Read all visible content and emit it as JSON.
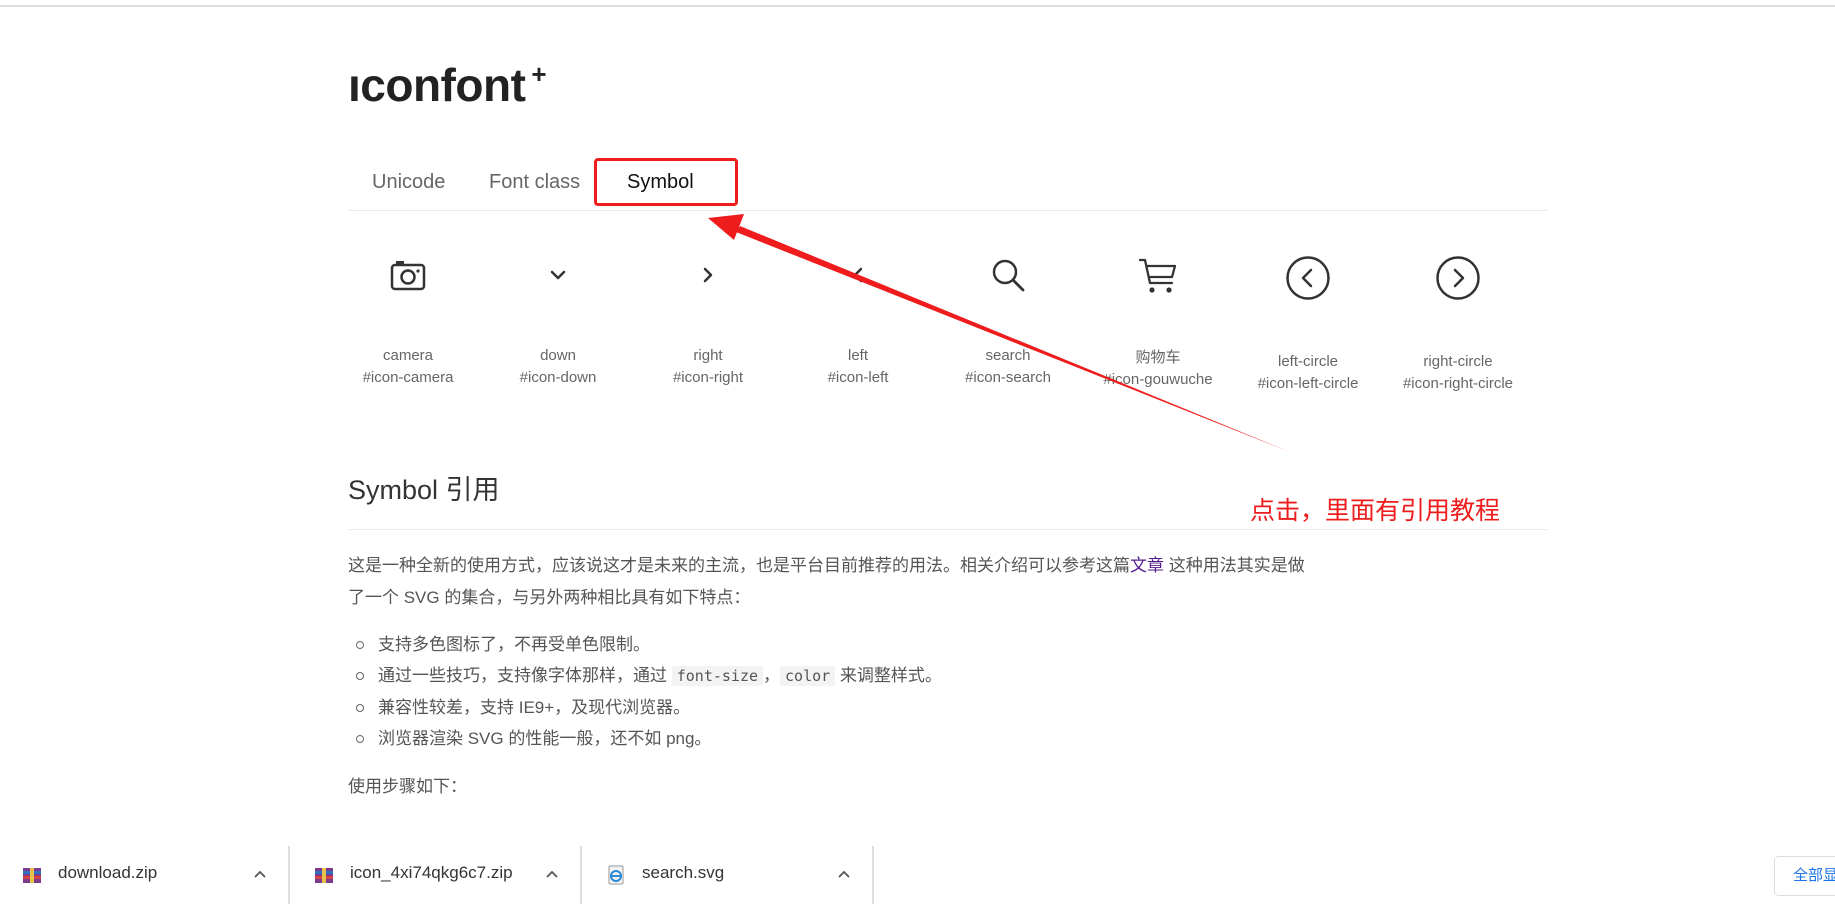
{
  "logo": {
    "text": "ıconfont",
    "plus": "+"
  },
  "tabs": [
    {
      "label": "Unicode",
      "active": false
    },
    {
      "label": "Font class",
      "active": false
    },
    {
      "label": "Symbol",
      "active": true
    }
  ],
  "icons": [
    {
      "name": "camera",
      "code": "#icon-camera",
      "icon": "camera-icon"
    },
    {
      "name": "down",
      "code": "#icon-down",
      "icon": "chevron-down-icon"
    },
    {
      "name": "right",
      "code": "#icon-right",
      "icon": "chevron-right-icon"
    },
    {
      "name": "left",
      "code": "#icon-left",
      "icon": "chevron-left-icon"
    },
    {
      "name": "search",
      "code": "#icon-search",
      "icon": "search-icon"
    },
    {
      "name": "购物车",
      "code": "#icon-gouwuche",
      "icon": "shopping-cart-icon"
    },
    {
      "name": "left-circle",
      "code": "#icon-left-circle",
      "icon": "left-circle-icon"
    },
    {
      "name": "right-circle",
      "code": "#icon-right-circle",
      "icon": "right-circle-icon"
    }
  ],
  "section": {
    "title": "Symbol 引用",
    "intro_before_link": "这是一种全新的使用方式，应该说这才是未来的主流，也是平台目前推荐的用法。相关介绍可以参考这篇",
    "intro_link": "文章",
    "intro_after_link": " 这种用法其实是做了一个 SVG 的集合，与另外两种相比具有如下特点：",
    "features": {
      "f1": "支持多色图标了，不再受单色限制。",
      "f2_before": "通过一些技巧，支持像字体那样，通过 ",
      "f2_code1": "font-size",
      "f2_sep": "，",
      "f2_code2": "color",
      "f2_after": " 来调整样式。",
      "f3": "兼容性较差，支持 IE9+，及现代浏览器。",
      "f4": "浏览器渲染 SVG 的性能一般，还不如 png。"
    },
    "steps": "使用步骤如下："
  },
  "annotation": {
    "text": "点击，里面有引用教程",
    "color": "#ee1c1c"
  },
  "downloads": [
    {
      "name": "download.zip",
      "icon": "zip-archive-icon"
    },
    {
      "name": "icon_4xi74qkg6c7.zip",
      "icon": "zip-archive-icon"
    },
    {
      "name": "search.svg",
      "icon": "svg-file-icon"
    }
  ],
  "show_all_label": "全部显示"
}
